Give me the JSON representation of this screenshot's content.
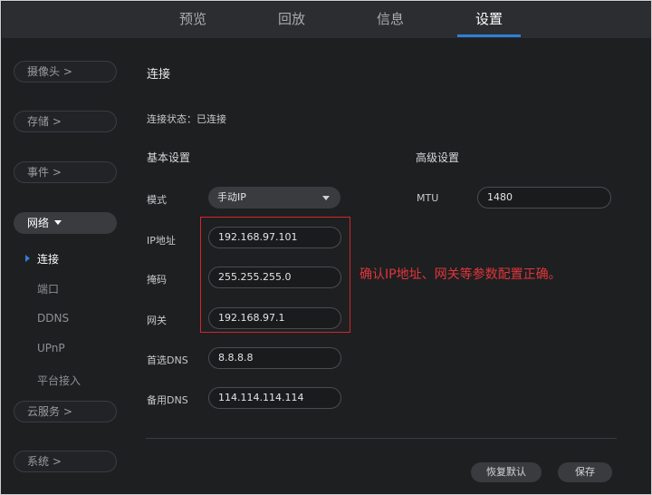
{
  "nav": {
    "tabs": [
      "预览",
      "回放",
      "信息",
      "设置"
    ],
    "active": "设置"
  },
  "sidebar": {
    "camera": "摄像头 >",
    "storage": "存储 >",
    "event": "事件 >",
    "network": "网络",
    "network_sub": [
      "连接",
      "端口",
      "DDNS",
      "UPnP",
      "平台接入"
    ],
    "cloud": "云服务 >",
    "system": "系统 >"
  },
  "main": {
    "title": "连接",
    "status": "连接状态：已连接",
    "basic_heading": "基本设置",
    "advanced_heading": "高级设置",
    "mode_label": "模式",
    "mode_value": "手动IP",
    "ip_label": "IP地址",
    "ip_value": "192.168.97.101",
    "mask_label": "掩码",
    "mask_value": "255.255.255.0",
    "gateway_label": "网关",
    "gateway_value": "192.168.97.1",
    "dns1_label": "首选DNS",
    "dns1_value": "8.8.8.8",
    "dns2_label": "备用DNS",
    "dns2_value": "114.114.114.114",
    "mtu_label": "MTU",
    "mtu_value": "1480",
    "annotation": "确认IP地址、网关等参数配置正确。",
    "restore_button": "恢复默认",
    "save_button": "保存"
  },
  "colors": {
    "accent": "#2f7fd8",
    "annotation_red": "#e0363a",
    "background": "#1e1f21"
  }
}
